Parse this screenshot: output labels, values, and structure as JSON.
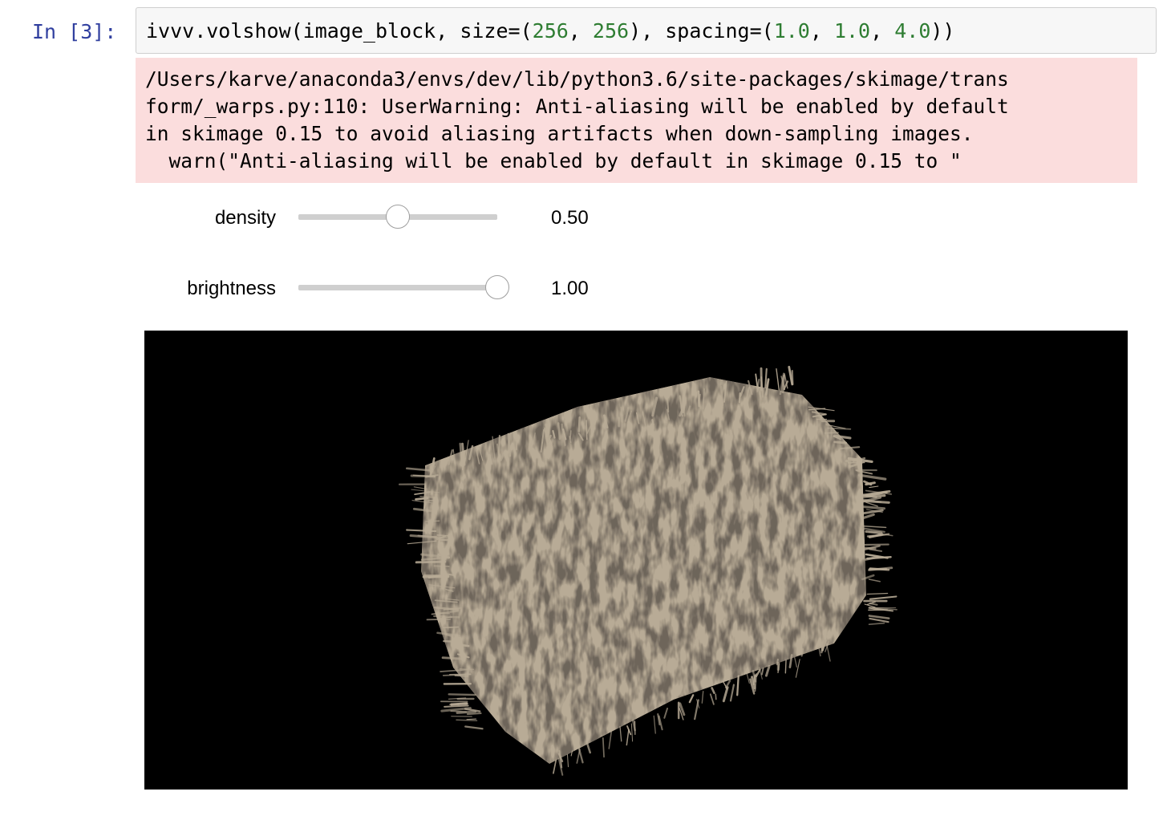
{
  "cell": {
    "prompt": "In [3]:",
    "code": {
      "prefix": "ivvv.volshow(image_block, size=(",
      "n1": "256",
      "sep1": ", ",
      "n2": "256",
      "mid": "), spacing=(",
      "n3": "1.0",
      "sep2": ", ",
      "n4": "1.0",
      "sep3": ", ",
      "n5": "4.0",
      "suffix": "))"
    }
  },
  "stderr": {
    "lines": [
      "/Users/karve/anaconda3/envs/dev/lib/python3.6/site-packages/skimage/trans",
      "form/_warps.py:110: UserWarning: Anti-aliasing will be enabled by default",
      "in skimage 0.15 to avoid aliasing artifacts when down-sampling images.",
      "  warn(\"Anti-aliasing will be enabled by default in skimage 0.15 to \""
    ]
  },
  "widgets": {
    "density": {
      "label": "density",
      "value": 0.5,
      "readout": "0.50"
    },
    "brightness": {
      "label": "brightness",
      "value": 1.0,
      "readout": "1.00"
    }
  },
  "viewer": {
    "background": "#000000",
    "volume_color": "#b8ab96"
  }
}
